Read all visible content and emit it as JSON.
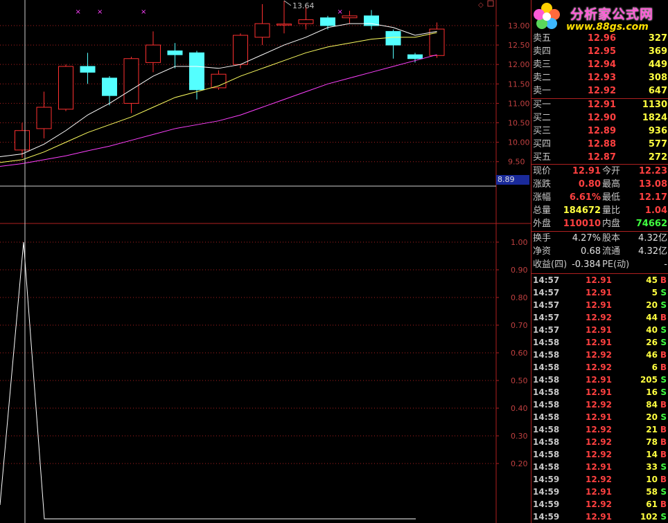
{
  "chart": {
    "price_axis": [
      "13.00",
      "12.50",
      "12.00",
      "11.50",
      "11.00",
      "10.50",
      "10.00",
      "9.50"
    ],
    "price_tag": "8.89",
    "peak_label": "13.64",
    "indicator_axis": [
      "1.00",
      "0.90",
      "0.80",
      "0.70",
      "0.60",
      "0.50",
      "0.40",
      "0.30",
      "0.20"
    ],
    "colors": {
      "up": "#ff3030",
      "down": "#54ffff",
      "ma_white": "#ffffff",
      "ma_yellow": "#ffff60",
      "ma_purple": "#ff40ff",
      "grid": "#b02020"
    }
  },
  "chart_data": {
    "type": "candlestick",
    "price_ylim": [
      8.89,
      13.64
    ],
    "candles": [
      {
        "o": 9.8,
        "c": 10.3,
        "h": 10.5,
        "l": 9.6
      },
      {
        "o": 10.35,
        "c": 10.9,
        "h": 11.3,
        "l": 10.1
      },
      {
        "o": 10.85,
        "c": 11.95,
        "h": 12.0,
        "l": 10.8
      },
      {
        "o": 11.95,
        "c": 11.8,
        "h": 12.3,
        "l": 11.5
      },
      {
        "o": 11.65,
        "c": 11.2,
        "h": 11.7,
        "l": 10.95
      },
      {
        "o": 11.0,
        "c": 12.15,
        "h": 12.2,
        "l": 10.75
      },
      {
        "o": 12.05,
        "c": 12.5,
        "h": 12.85,
        "l": 11.8
      },
      {
        "o": 12.35,
        "c": 12.25,
        "h": 12.55,
        "l": 11.9
      },
      {
        "o": 12.3,
        "c": 11.35,
        "h": 12.35,
        "l": 11.1
      },
      {
        "o": 11.4,
        "c": 11.75,
        "h": 11.85,
        "l": 11.35
      },
      {
        "o": 12.0,
        "c": 12.75,
        "h": 12.8,
        "l": 11.9
      },
      {
        "o": 12.7,
        "c": 13.05,
        "h": 13.55,
        "l": 12.5
      },
      {
        "o": 13.04,
        "c": 13.04,
        "h": 13.64,
        "l": 12.8
      },
      {
        "o": 13.05,
        "c": 13.15,
        "h": 13.5,
        "l": 12.9
      },
      {
        "o": 13.2,
        "c": 13.0,
        "h": 13.25,
        "l": 12.9
      },
      {
        "o": 13.2,
        "c": 13.25,
        "h": 13.38,
        "l": 13.05
      },
      {
        "o": 13.25,
        "c": 13.0,
        "h": 13.4,
        "l": 12.9
      },
      {
        "o": 12.85,
        "c": 12.5,
        "h": 12.9,
        "l": 12.15
      },
      {
        "o": 12.25,
        "c": 12.15,
        "h": 12.3,
        "l": 12.05
      },
      {
        "o": 12.23,
        "c": 12.91,
        "h": 13.08,
        "l": 12.17
      }
    ],
    "ma_white": [
      9.7,
      9.95,
      10.3,
      10.7,
      11.0,
      11.35,
      11.7,
      11.95,
      11.95,
      11.9,
      12.0,
      12.25,
      12.5,
      12.7,
      12.95,
      13.05,
      13.05,
      12.95,
      12.75,
      12.85
    ],
    "ma_yellow": [
      9.55,
      9.75,
      10.0,
      10.25,
      10.45,
      10.65,
      10.9,
      11.15,
      11.3,
      11.45,
      11.7,
      11.9,
      12.1,
      12.3,
      12.45,
      12.55,
      12.65,
      12.7,
      12.7,
      12.82
    ],
    "ma_purple": [
      9.45,
      9.55,
      9.65,
      9.78,
      9.9,
      10.05,
      10.2,
      10.35,
      10.45,
      10.55,
      10.7,
      10.9,
      11.1,
      11.3,
      11.5,
      11.65,
      11.8,
      11.95,
      12.1,
      12.25
    ],
    "indicator_ylim": [
      0,
      1.05
    ],
    "indicator": [
      0.05,
      1.0,
      0,
      0,
      0,
      0,
      0,
      0,
      0,
      0,
      0,
      0,
      0,
      0,
      0,
      0,
      0,
      0,
      0,
      0
    ]
  },
  "panel": {
    "logo_cn": "分析家公式网",
    "logo_url": "www.88gs.com",
    "asks": [
      {
        "label": "卖五",
        "price": "12.96",
        "vol": "327"
      },
      {
        "label": "卖四",
        "price": "12.95",
        "vol": "369"
      },
      {
        "label": "卖三",
        "price": "12.94",
        "vol": "449"
      },
      {
        "label": "卖二",
        "price": "12.93",
        "vol": "308"
      },
      {
        "label": "卖一",
        "price": "12.92",
        "vol": "647"
      }
    ],
    "bids": [
      {
        "label": "买一",
        "price": "12.91",
        "vol": "1130"
      },
      {
        "label": "买二",
        "price": "12.90",
        "vol": "1824"
      },
      {
        "label": "买三",
        "price": "12.89",
        "vol": "936"
      },
      {
        "label": "买四",
        "price": "12.88",
        "vol": "577"
      },
      {
        "label": "买五",
        "price": "12.87",
        "vol": "272"
      }
    ],
    "quote": [
      {
        "l1": "现价",
        "v1": "12.91",
        "c1": "#ff4040",
        "l2": "今开",
        "v2": "12.23",
        "c2": "#ff4040"
      },
      {
        "l1": "涨跌",
        "v1": "0.80",
        "c1": "#ff4040",
        "l2": "最高",
        "v2": "13.08",
        "c2": "#ff4040"
      },
      {
        "l1": "涨幅",
        "v1": "6.61%",
        "c1": "#ff4040",
        "l2": "最低",
        "v2": "12.17",
        "c2": "#ff4040"
      },
      {
        "l1": "总量",
        "v1": "184672",
        "c1": "#ffff40",
        "l2": "量比",
        "v2": "1.04",
        "c2": "#ff4040"
      },
      {
        "l1": "外盘",
        "v1": "110010",
        "c1": "#ff4040",
        "l2": "内盘",
        "v2": "74662",
        "c2": "#40ff40"
      }
    ],
    "info": [
      {
        "l1": "换手",
        "v1": "4.27%",
        "l2": "股本",
        "v2": "4.32亿"
      },
      {
        "l1": "净资",
        "v1": "0.68",
        "l2": "流通",
        "v2": "4.32亿"
      },
      {
        "l1": "收益(四)",
        "v1": "-0.384",
        "l2": "PE(动)",
        "v2": "-"
      }
    ],
    "ticks": [
      {
        "t": "14:57",
        "p": "12.91",
        "v": "45",
        "bs": "B"
      },
      {
        "t": "14:57",
        "p": "12.91",
        "v": "5",
        "bs": "S"
      },
      {
        "t": "14:57",
        "p": "12.91",
        "v": "20",
        "bs": "S"
      },
      {
        "t": "14:57",
        "p": "12.92",
        "v": "44",
        "bs": "B"
      },
      {
        "t": "14:57",
        "p": "12.91",
        "v": "40",
        "bs": "S"
      },
      {
        "t": "14:58",
        "p": "12.91",
        "v": "26",
        "bs": "S"
      },
      {
        "t": "14:58",
        "p": "12.92",
        "v": "46",
        "bs": "B"
      },
      {
        "t": "14:58",
        "p": "12.92",
        "v": "6",
        "bs": "B"
      },
      {
        "t": "14:58",
        "p": "12.91",
        "v": "205",
        "bs": "S"
      },
      {
        "t": "14:58",
        "p": "12.91",
        "v": "16",
        "bs": "S"
      },
      {
        "t": "14:58",
        "p": "12.92",
        "v": "84",
        "bs": "B"
      },
      {
        "t": "14:58",
        "p": "12.91",
        "v": "20",
        "bs": "S"
      },
      {
        "t": "14:58",
        "p": "12.92",
        "v": "21",
        "bs": "B"
      },
      {
        "t": "14:58",
        "p": "12.92",
        "v": "78",
        "bs": "B"
      },
      {
        "t": "14:58",
        "p": "12.92",
        "v": "14",
        "bs": "B"
      },
      {
        "t": "14:58",
        "p": "12.91",
        "v": "33",
        "bs": "S"
      },
      {
        "t": "14:59",
        "p": "12.92",
        "v": "10",
        "bs": "B"
      },
      {
        "t": "14:59",
        "p": "12.91",
        "v": "58",
        "bs": "S"
      },
      {
        "t": "14:59",
        "p": "12.92",
        "v": "61",
        "bs": "B"
      },
      {
        "t": "14:59",
        "p": "12.91",
        "v": "102",
        "bs": "S"
      }
    ]
  }
}
